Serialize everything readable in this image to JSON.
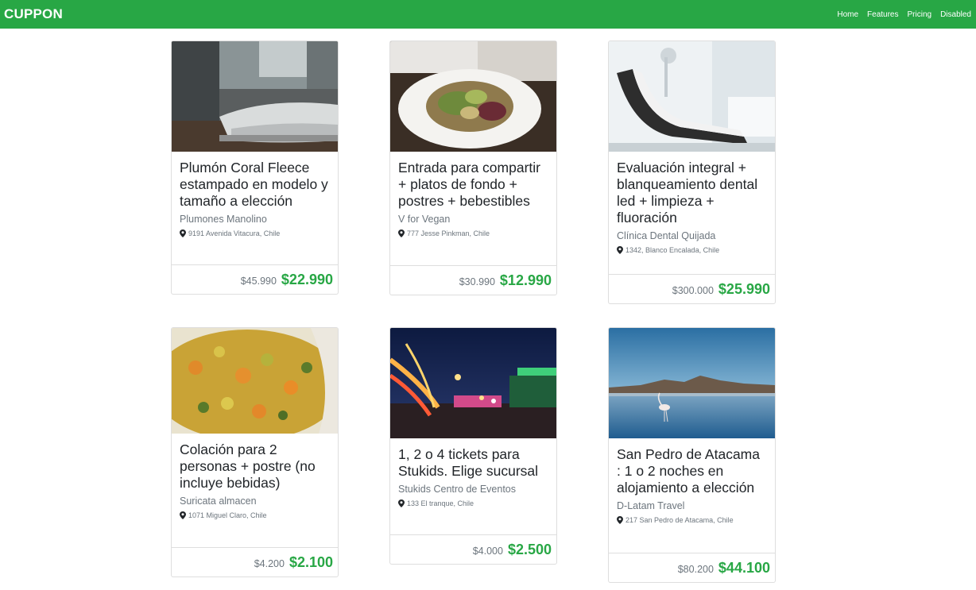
{
  "app": {
    "brand": "CUPPON"
  },
  "nav": {
    "items": [
      {
        "label": "Home"
      },
      {
        "label": "Features"
      },
      {
        "label": "Pricing"
      },
      {
        "label": "Disabled"
      }
    ]
  },
  "deals": [
    {
      "title": "Plumón Coral Fleece estampado en modelo y tamaño a elección",
      "merchant": "Plumones Manolino",
      "address": "9191 Avenida Vitacura, Chile",
      "old_price": "$45.990",
      "new_price": "$22.990",
      "image": "bedroom"
    },
    {
      "title": "Entrada para compartir + platos de fondo + postres + bebestibles",
      "merchant": "V for Vegan",
      "address": "777 Jesse Pinkman, Chile",
      "old_price": "$30.990",
      "new_price": "$12.990",
      "image": "salad-plate"
    },
    {
      "title": "Evaluación integral + blanqueamiento dental led + limpieza + fluoración",
      "merchant": "Clínica Dental Quijada",
      "address": "1342, Blanco Encalada, Chile",
      "old_price": "$300.000",
      "new_price": "$25.990",
      "image": "dental-chair"
    },
    {
      "title": "Colación para 2 personas + postre (no incluye bebidas)",
      "merchant": "Suricata almacen",
      "address": "1071 Miguel Claro, Chile",
      "old_price": "$4.200",
      "new_price": "$2.100",
      "image": "food-bowl"
    },
    {
      "title": "1, 2 o 4 tickets para Stukids. Elige sucursal",
      "merchant": "Stukids Centro de Eventos",
      "address": "133 El tranque, Chile",
      "old_price": "$4.000",
      "new_price": "$2.500",
      "image": "night-fair"
    },
    {
      "title": "San Pedro de Atacama : 1 o 2 noches en alojamiento a elección",
      "merchant": "D-Latam Travel",
      "address": "217 San Pedro de Atacama, Chile",
      "old_price": "$80.200",
      "new_price": "$44.100",
      "image": "salt-lake-flamingo"
    }
  ],
  "colors": {
    "brand_green": "#28a745",
    "muted": "#6c757d"
  }
}
